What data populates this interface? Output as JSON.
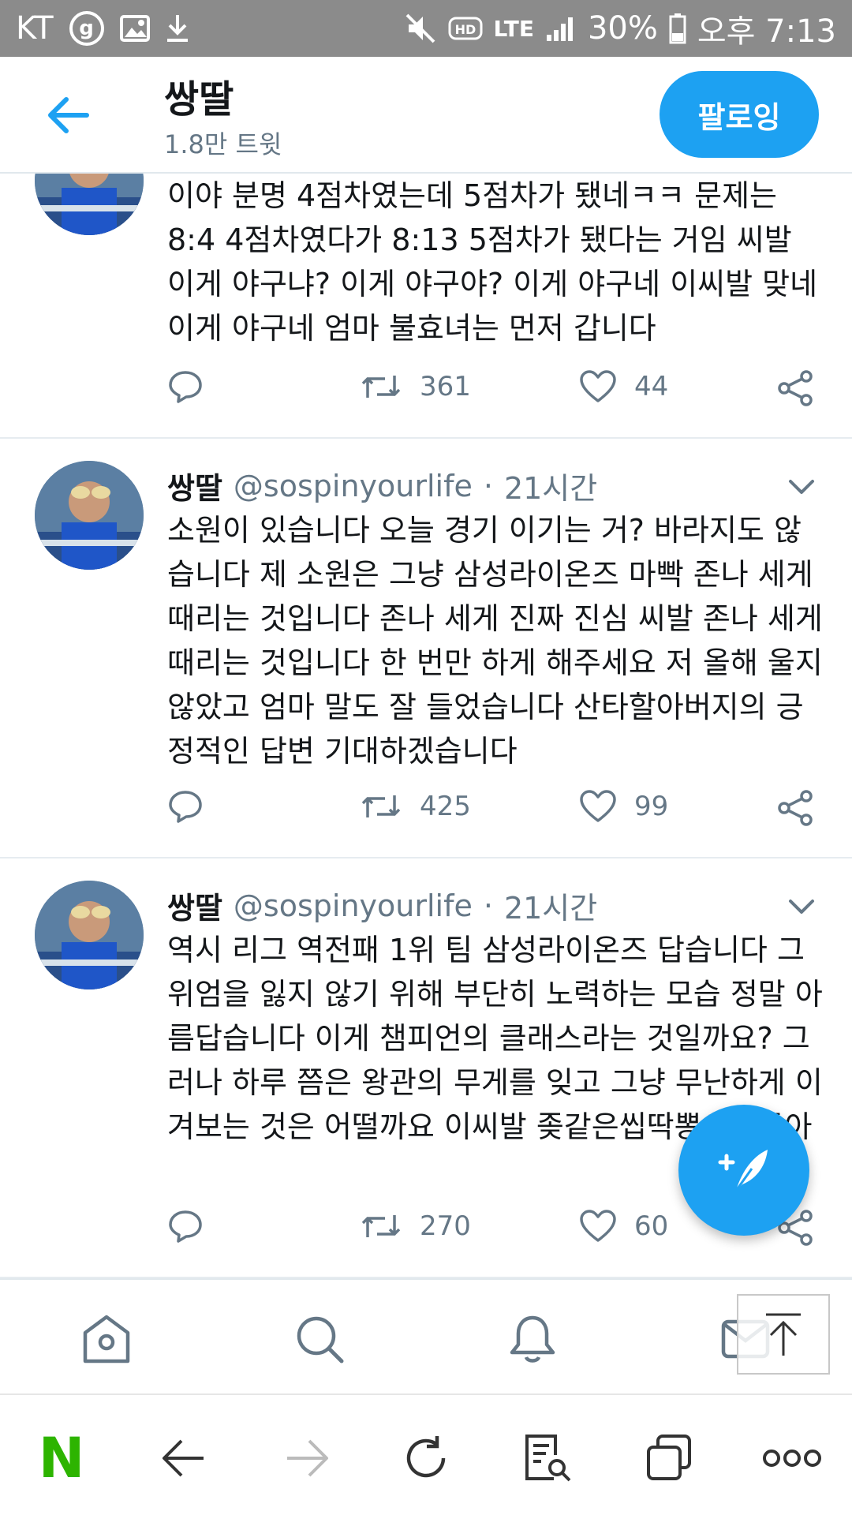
{
  "status_bar": {
    "carrier": "KT",
    "network": "LTE",
    "battery": "30%",
    "time": "오후 7:13"
  },
  "header": {
    "title": "쌍딸",
    "subtitle": "1.8만 트윗",
    "follow_label": "팔로잉"
  },
  "tweets": [
    {
      "name": "",
      "handle": "",
      "time": "",
      "text": "이야 분명 4점차였는데 5점차가 됐네ㅋㅋ 문제는 8:4 4점차였다가 8:13 5점차가 됐다는 거임 씨발 이게 야구냐? 이게 야구야? 이게 야구네 이씨발 맞네 이게 야구네 엄마 불효녀는 먼저 갑니다",
      "retweets": "361",
      "likes": "44"
    },
    {
      "name": "쌍딸",
      "handle": "@sospinyourlife",
      "time": "21시간",
      "text": "소원이 있습니다 오늘 경기 이기는 거? 바라지도 않습니다 제 소원은 그냥 삼성라이온즈 마빡 존나 세게 때리는 것입니다 존나 세게 진짜 진심 씨발 존나 세게 때리는 것입니다 한 번만 하게 해주세요 저 올해 울지 않았고 엄마 말도 잘 들었습니다 산타할아버지의 긍정적인 답변 기대하겠습니다",
      "retweets": "425",
      "likes": "99"
    },
    {
      "name": "쌍딸",
      "handle": "@sospinyourlife",
      "time": "21시간",
      "text": "역시 리그 역전패 1위 팀 삼성라이온즈 답습니다 그 위엄을 잃지 않기 위해 부단히 노력하는 모습 정말 아름답습니다 이게 챔피언의 클래스라는 것일까요? 그러나 하루 쯤은 왕관의 무게를 잊고 그냥 무난하게 이겨보는 것은 어떨까요 이씨발 좆같은씹딱뽕새끼들아",
      "retweets": "270",
      "likes": "60"
    }
  ],
  "icons": {
    "accent": "#1da1f2",
    "naver_green": "#2db400"
  },
  "browser": {
    "logo": "N"
  }
}
